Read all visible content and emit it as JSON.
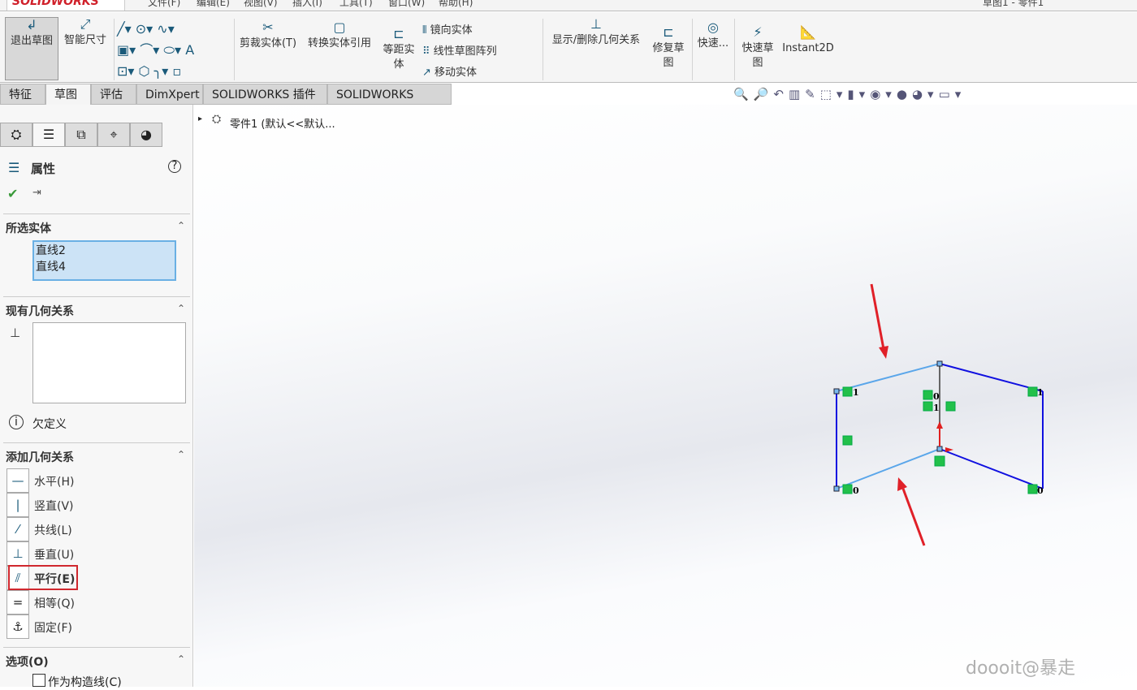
{
  "app": {
    "logo": "SOLIDWORKS",
    "title": "草图1 - 零件1"
  },
  "menu": [
    "文件(F)",
    "编辑(E)",
    "视图(V)",
    "插入(I)",
    "工具(T)",
    "窗口(W)",
    "帮助(H)"
  ],
  "ribbon": {
    "exit_sketch": "退出草图",
    "smart_dim": "智能尺寸",
    "trim": "剪裁实体(T)",
    "convert": "转换实体引用",
    "offset": "等距实体",
    "mirror": "镜向实体",
    "linear_pattern": "线性草图阵列",
    "move": "移动实体",
    "show_relations": "显示/删除几何关系",
    "repair": "修复草图",
    "quick": "快速...",
    "rapid_sketch": "快速草图",
    "instant2d": "Instant2D"
  },
  "tabs": [
    "特征",
    "草图",
    "评估",
    "DimXpert",
    "SOLIDWORKS 插件",
    "SOLIDWORKS MBD"
  ],
  "active_tab": "草图",
  "tree": {
    "root": "零件1  (默认<<默认..."
  },
  "panel": {
    "title": "属性",
    "selected_header": "所选实体",
    "selected": [
      "直线2",
      "直线4"
    ],
    "existing_header": "现有几何关系",
    "status": "欠定义",
    "add_header": "添加几何关系",
    "relations": [
      {
        "label": "水平(H)",
        "icon": "horizontal-icon"
      },
      {
        "label": "竖直(V)",
        "icon": "vertical-icon"
      },
      {
        "label": "共线(L)",
        "icon": "collinear-icon"
      },
      {
        "label": "垂直(U)",
        "icon": "perpendicular-icon"
      },
      {
        "label": "平行(E)",
        "icon": "parallel-icon",
        "highlighted": true
      },
      {
        "label": "相等(Q)",
        "icon": "equal-icon"
      },
      {
        "label": "固定(F)",
        "icon": "fix-icon"
      }
    ],
    "options_header": "选项(O)",
    "construction": "作为构造线(C)"
  },
  "sketch": {
    "labels": [
      "1",
      "0",
      "0",
      "1",
      "1",
      "0"
    ]
  },
  "colors": {
    "selected_line": "#5aa6ea",
    "line": "#1010e0",
    "arrow": "#e02020",
    "relation": "#22c04a"
  },
  "watermark": "doooit@暴走"
}
